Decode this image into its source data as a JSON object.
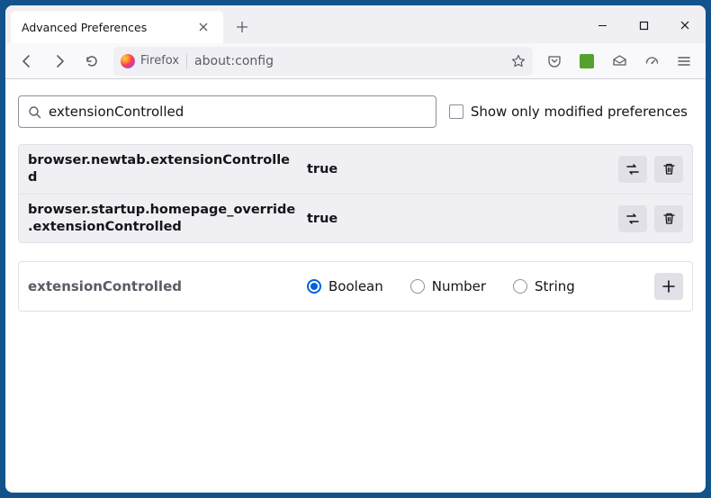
{
  "window": {
    "tab_title": "Advanced Preferences",
    "url_identity": "Firefox",
    "url": "about:config"
  },
  "search": {
    "value": "extensionControlled",
    "filter_label": "Show only modified preferences"
  },
  "prefs": [
    {
      "name": "browser.newtab.extensionControlled",
      "value": "true"
    },
    {
      "name": "browser.startup.homepage_override.extensionControlled",
      "value": "true"
    }
  ],
  "new_pref": {
    "name": "extensionControlled",
    "types": [
      "Boolean",
      "Number",
      "String"
    ],
    "selected": "Boolean"
  }
}
